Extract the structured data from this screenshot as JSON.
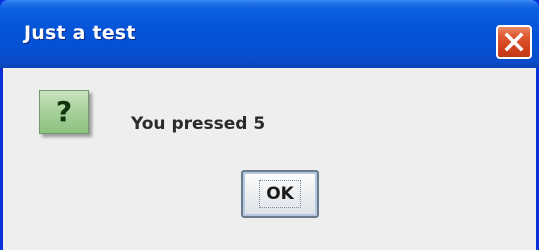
{
  "window": {
    "title": "Just a test",
    "close_icon": "close-icon"
  },
  "dialog": {
    "icon": "question-icon",
    "icon_glyph": "?",
    "message": "You pressed 5",
    "ok_label": "OK"
  },
  "colors": {
    "titlebar": "#0655d8",
    "close_button": "#d4441f",
    "client_background": "#eeeeee",
    "icon_background": "#a8d29c"
  }
}
